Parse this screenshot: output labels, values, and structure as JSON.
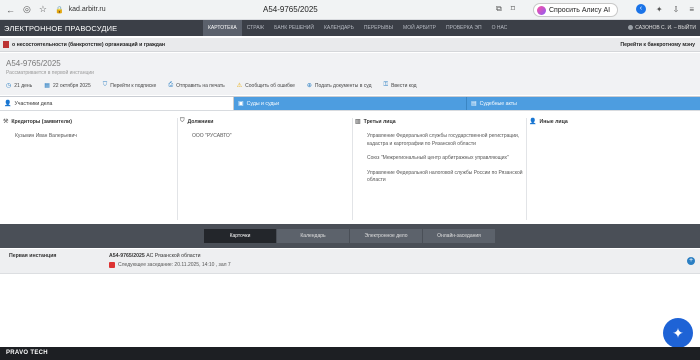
{
  "browser": {
    "url": "kad.arbitr.ru",
    "tab_title": "А54-9765/2025",
    "alice_label": "Спросить Алису AI"
  },
  "header": {
    "logo": "ЭЛЕКТРОННОЕ ПРАВОСУДИЕ",
    "nav": [
      "КАРТОТЕКА",
      "СТРАЖ",
      "БАНК РЕШЕНИЙ",
      "КАЛЕНДАРЬ",
      "ПЕРЕРЫВЫ",
      "МОЙ АРБИТР",
      "ПРОВЕРКА ЭП",
      "О НАС"
    ],
    "user": "САЗОНОВ С. И. – ВЫЙТИ"
  },
  "category": {
    "title": "о несостоятельности (банкротстве) организаций и граждан",
    "link": "Перейти к банкротному мэну"
  },
  "case": {
    "number": "А54-9765/2025",
    "instance": "Рассматривается в первой инстанции",
    "actions": {
      "days": "21 день",
      "date": "22 октября 2025",
      "subscribe": "Перейти к подписке",
      "print": "Отправить на печать",
      "report": "Сообщить об ошибке",
      "submit": "Подать документы в суд",
      "code": "Ввести код"
    }
  },
  "tabs": {
    "participants": "Участники дела",
    "courts": "Суды и судьи",
    "acts": "Судебные акты"
  },
  "parties": {
    "creditors": {
      "title": "Кредиторы (заявители)",
      "items": [
        "Кузьмин Иван Валерьевич"
      ]
    },
    "debtors": {
      "title": "Должники",
      "items": [
        "ООО \"РУСАВТО\""
      ]
    },
    "third": {
      "title": "Третьи лица",
      "items": [
        "Управление Федеральной службы государственной регистрации, кадастра и картографии по Рязанской области",
        "Союз \"Межрегиональный центр арбитражных управляющих\"",
        "Управление Федеральной налоговой службы России по Рязанской области"
      ]
    },
    "others": {
      "title": "Иные лица",
      "items": []
    }
  },
  "bottom_tabs": [
    "Карточки",
    "Календарь",
    "Электронное дело",
    "Онлайн-заседания"
  ],
  "instance_row": {
    "label": "Первая инстанция",
    "case_number": "А54-9765/2025",
    "court": "АС Рязанской области",
    "next": "Следующее заседание: 20.11.2025, 14:10 , зал 7"
  },
  "footer": {
    "brand": "PRAVO TECH"
  },
  "colors": {
    "tab_blue": "#4d9de0",
    "header_dark": "#3b3f47",
    "footer_dark": "#1d1f23",
    "emblem": "#1e63d6"
  }
}
